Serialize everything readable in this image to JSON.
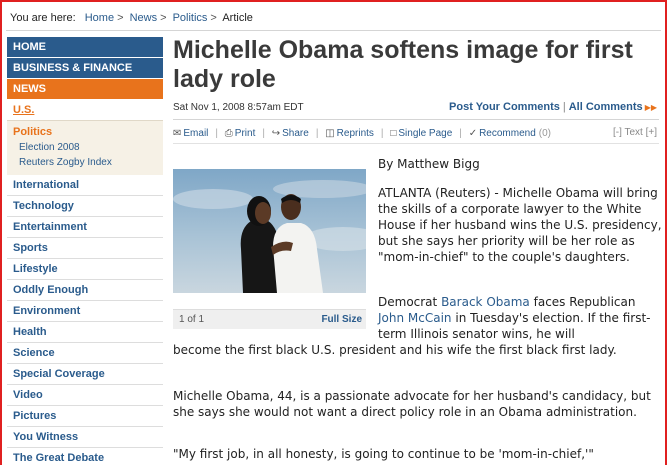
{
  "breadcrumb": {
    "label": "You are here:",
    "items": [
      "Home",
      "News",
      "Politics"
    ],
    "current": "Article"
  },
  "nav": {
    "home": "HOME",
    "business": "BUSINESS & FINANCE",
    "news": "NEWS",
    "us": "U.S.",
    "politics": "Politics",
    "sub": [
      "Election 2008",
      "Reuters Zogby Index"
    ],
    "items": [
      "International",
      "Technology",
      "Entertainment",
      "Sports",
      "Lifestyle",
      "Oddly Enough",
      "Environment",
      "Health",
      "Science",
      "Special Coverage",
      "Video",
      "Pictures",
      "You Witness",
      "The Great Debate"
    ]
  },
  "article": {
    "headline": "Michelle Obama softens image for first lady role",
    "dateline": "Sat Nov 1, 2008 8:57am EDT",
    "post_comments": "Post Your Comments",
    "all_comments": "All Comments",
    "byline": "By Matthew Bigg",
    "p1": "ATLANTA (Reuters) - Michelle Obama will bring the skills of a corporate lawyer to the White House if her husband wins the U.S. presidency, but she says her priority will be her role as \"mom-in-chief\" to the couple's daughters.",
    "p2_lead": "Democrat",
    "p2_link1": "Barack Obama",
    "p2_mid": "faces Republican",
    "p2_link2": "John McCain",
    "p2_rest_a": "in Tuesday's election. If the first-term Illinois senator wins, he will",
    "p2_rest_b": "become the first black U.S. president and his wife the first black first lady.",
    "p3": "Michelle Obama, 44, is a passionate advocate for her husband's candidacy, but she says she would not want a direct policy role in an Obama administration.",
    "p4": "\"My first job, in all honesty, is going to continue to be 'mom-in-chief,'\""
  },
  "tools": {
    "email": "Email",
    "print": "Print",
    "share": "Share",
    "reprints": "Reprints",
    "single_page": "Single Page",
    "recommend": "Recommend",
    "recommend_count": "(0)",
    "text_size": "[-] Text [+]"
  },
  "photo": {
    "counter": "1 of 1",
    "full_size": "Full Size"
  },
  "colors": {
    "nav_blue": "#2a5b8c",
    "nav_orange": "#e8731c",
    "link": "#2a5b8c"
  }
}
